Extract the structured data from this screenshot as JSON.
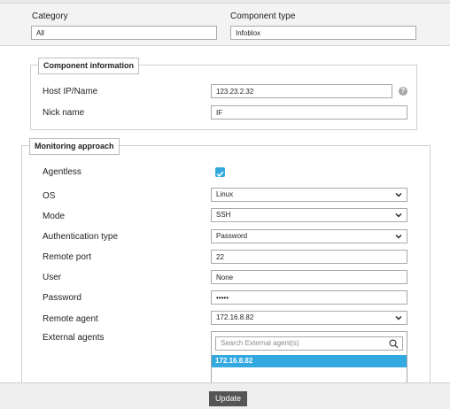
{
  "header": {
    "category_label": "Category",
    "category_value": "All",
    "component_type_label": "Component type",
    "component_type_value": "Infoblox"
  },
  "component_info": {
    "legend": "Component information",
    "host_label": "Host IP/Name",
    "host_value": "123.23.2.32",
    "help_icon": "?",
    "nick_label": "Nick name",
    "nick_value": "IF"
  },
  "monitoring": {
    "legend": "Monitoring approach",
    "agentless_label": "Agentless",
    "agentless_checked": true,
    "os_label": "OS",
    "os_value": "Linux",
    "mode_label": "Mode",
    "mode_value": "SSH",
    "auth_label": "Authentication type",
    "auth_value": "Password",
    "port_label": "Remote port",
    "port_value": "22",
    "user_label": "User",
    "user_value": "None",
    "password_label": "Password",
    "password_value": "•••••",
    "remote_agent_label": "Remote agent",
    "remote_agent_value": "172.16.8.82",
    "external_agents_label": "External agents",
    "external_search_placeholder": "Search External agent(s)",
    "external_agents_options": [
      "172.16.8.82"
    ]
  },
  "footer": {
    "update_label": "Update"
  },
  "colors": {
    "accent": "#33a9e0",
    "button": "#555555"
  },
  "icons": [
    "help-icon",
    "checkmark-icon",
    "chevron-down-icon",
    "search-icon"
  ]
}
